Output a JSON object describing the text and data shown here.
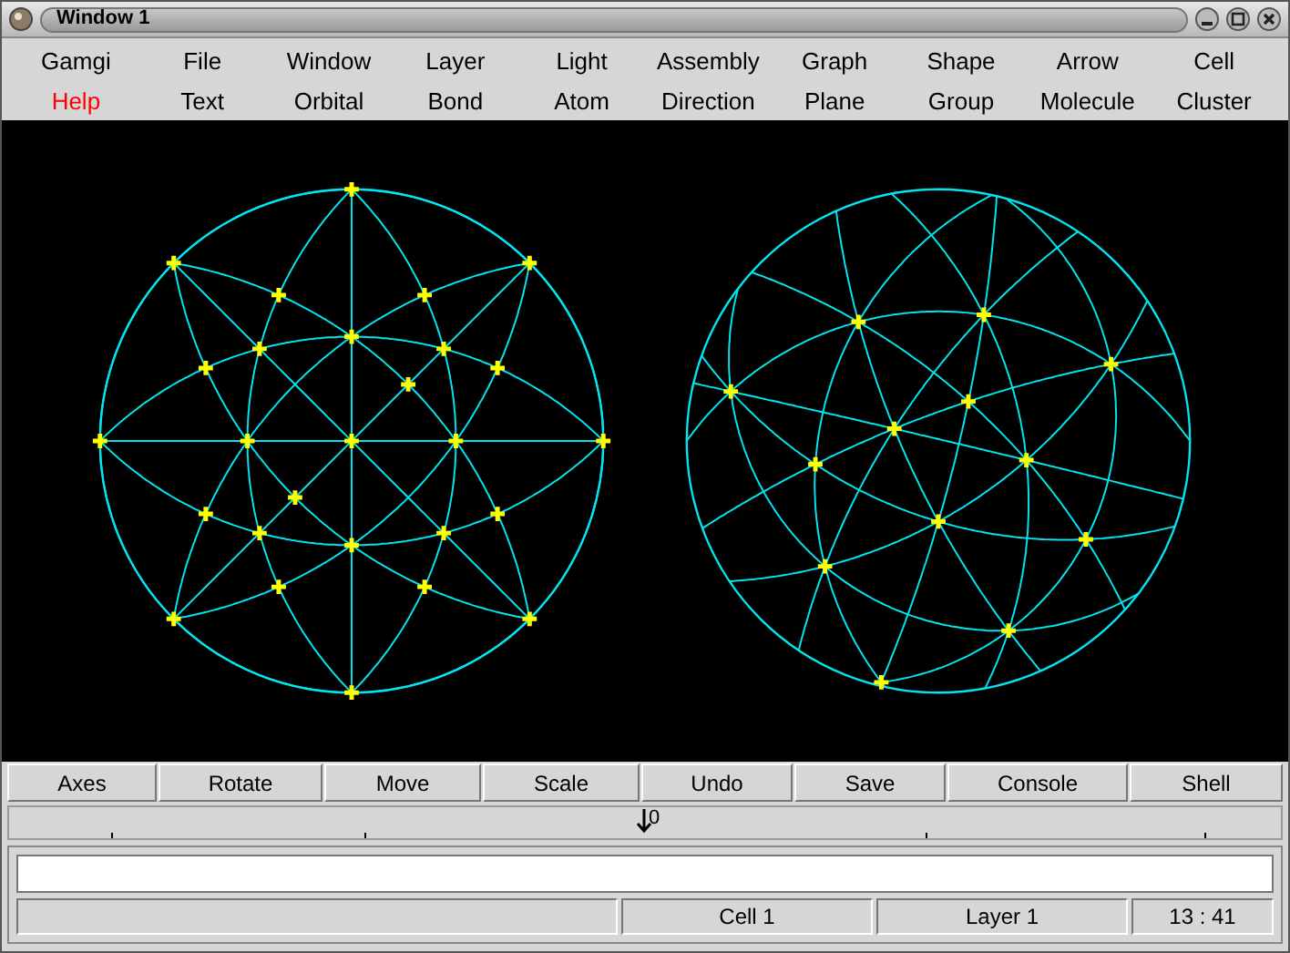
{
  "window": {
    "title": "Window 1"
  },
  "menu_rows": [
    [
      {
        "label": "Gamgi",
        "highlighted": false
      },
      {
        "label": "File",
        "highlighted": false
      },
      {
        "label": "Window",
        "highlighted": false
      },
      {
        "label": "Layer",
        "highlighted": false
      },
      {
        "label": "Light",
        "highlighted": false
      },
      {
        "label": "Assembly",
        "highlighted": false
      },
      {
        "label": "Graph",
        "highlighted": false
      },
      {
        "label": "Shape",
        "highlighted": false
      },
      {
        "label": "Arrow",
        "highlighted": false
      },
      {
        "label": "Cell",
        "highlighted": false
      }
    ],
    [
      {
        "label": "Help",
        "highlighted": true
      },
      {
        "label": "Text",
        "highlighted": false
      },
      {
        "label": "Orbital",
        "highlighted": false
      },
      {
        "label": "Bond",
        "highlighted": false
      },
      {
        "label": "Atom",
        "highlighted": false
      },
      {
        "label": "Direction",
        "highlighted": false
      },
      {
        "label": "Plane",
        "highlighted": false
      },
      {
        "label": "Group",
        "highlighted": false
      },
      {
        "label": "Molecule",
        "highlighted": false
      },
      {
        "label": "Cluster",
        "highlighted": false
      }
    ]
  ],
  "toolbar": [
    "Axes",
    "Rotate",
    "Move",
    "Scale",
    "Undo",
    "Save",
    "Console",
    "Shell"
  ],
  "slider": {
    "label": "0",
    "level": 0.5
  },
  "status_bar": [
    "Cell 1",
    "Layer 1",
    "13 : 41"
  ]
}
